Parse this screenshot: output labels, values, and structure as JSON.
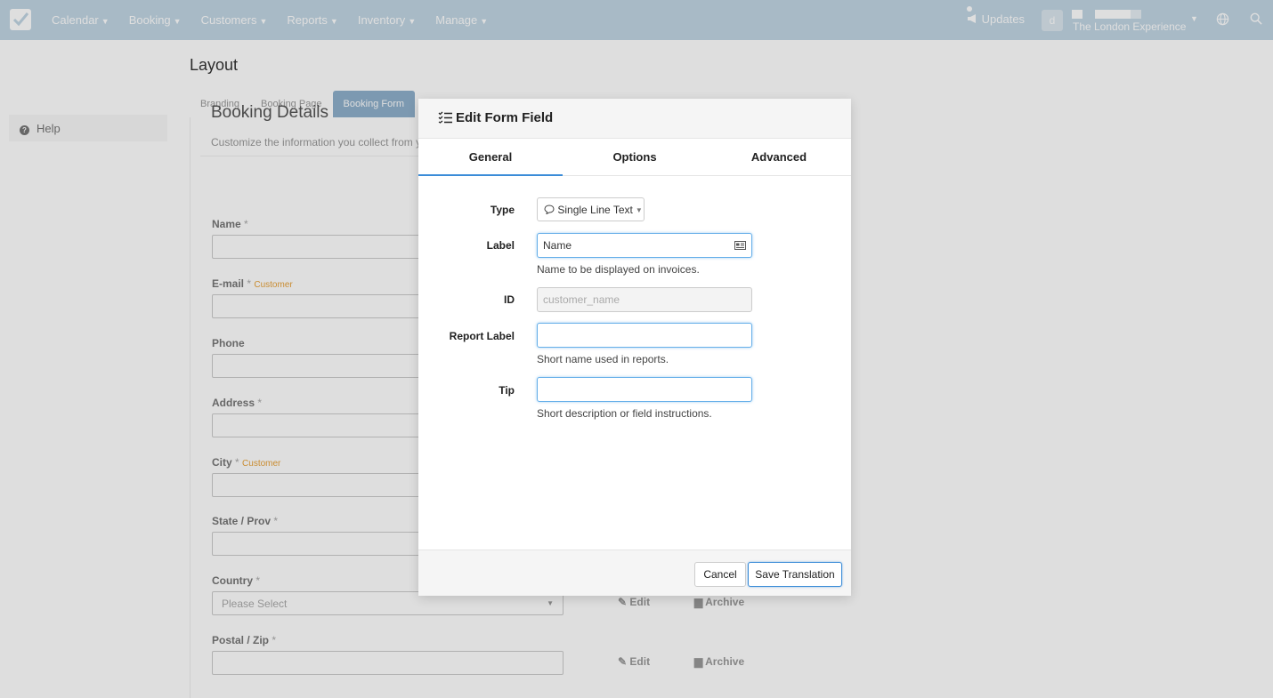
{
  "navbar": {
    "menu": [
      {
        "label": "Calendar"
      },
      {
        "label": "Booking"
      },
      {
        "label": "Customers"
      },
      {
        "label": "Reports"
      },
      {
        "label": "Inventory"
      },
      {
        "label": "Manage"
      }
    ],
    "updates_label": "Updates",
    "avatar_initial": "d",
    "account_name": "The London Experience"
  },
  "sidebar": {
    "help_label": "Help"
  },
  "page": {
    "title": "Layout",
    "subtabs": [
      "Branding",
      "Booking Page",
      "Booking Form"
    ],
    "section_title": "Booking Details",
    "section_desc": "Customize the information you collect from y",
    "fields": [
      {
        "label": "Name",
        "req": "*",
        "tag": ""
      },
      {
        "label": "E-mail",
        "req": "*",
        "tag": "Customer"
      },
      {
        "label": "Phone",
        "req": "",
        "tag": ""
      },
      {
        "label": "Address",
        "req": "*",
        "tag": ""
      },
      {
        "label": "City",
        "req": "*",
        "tag": "Customer"
      },
      {
        "label": "State / Prov",
        "req": "*",
        "tag": ""
      },
      {
        "label": "Country",
        "req": "*",
        "tag": ""
      },
      {
        "label": "Postal / Zip",
        "req": "*",
        "tag": ""
      }
    ],
    "country_placeholder": "Please Select",
    "edit_label": "Edit",
    "archive_label": "Archive"
  },
  "modal": {
    "title": "Edit Form Field",
    "tabs": [
      "General",
      "Options",
      "Advanced"
    ],
    "active_tab": "General",
    "type_label": "Type",
    "type_value": "Single Line Text",
    "label_label": "Label",
    "label_value": "Name",
    "label_help": "Name to be displayed on invoices.",
    "id_label": "ID",
    "id_placeholder": "customer_name",
    "report_label_label": "Report Label",
    "report_label_value": "",
    "report_label_help": "Short name used in reports.",
    "tip_label": "Tip",
    "tip_value": "",
    "tip_help": "Short description or field instructions.",
    "cancel_label": "Cancel",
    "save_label": "Save Translation"
  },
  "colors": {
    "navbar": "#c2d6e4",
    "accent": "#3b8cd8",
    "customer_tag": "#e8a33b"
  }
}
